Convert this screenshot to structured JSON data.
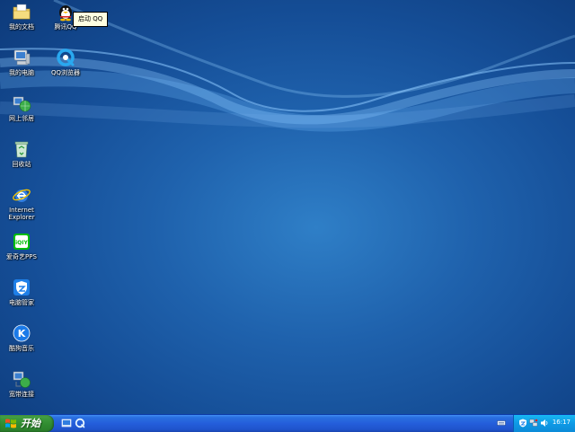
{
  "desktop": {
    "icons": [
      {
        "label": "我的文档"
      },
      {
        "label": "腾讯QQ"
      },
      {
        "label": "我的电脑"
      },
      {
        "label": "QQ浏览器"
      },
      {
        "label": "网上邻居"
      },
      {
        "label": "回收站"
      },
      {
        "label": "Internet\nExplorer"
      },
      {
        "label": "爱奇艺PPS"
      },
      {
        "label": "电脑管家"
      },
      {
        "label": "酷狗音乐"
      },
      {
        "label": "宽带连接"
      }
    ],
    "tooltip": "启动 QQ"
  },
  "taskbar": {
    "start_label": "开始",
    "clock": "16:17"
  },
  "colors": {
    "desktop_center": "#2f7fc7",
    "desktop_edge": "#0d3a7a",
    "taskbar": "#245edb",
    "start_green": "#3c9a3c",
    "tray": "#0f9ae6"
  }
}
